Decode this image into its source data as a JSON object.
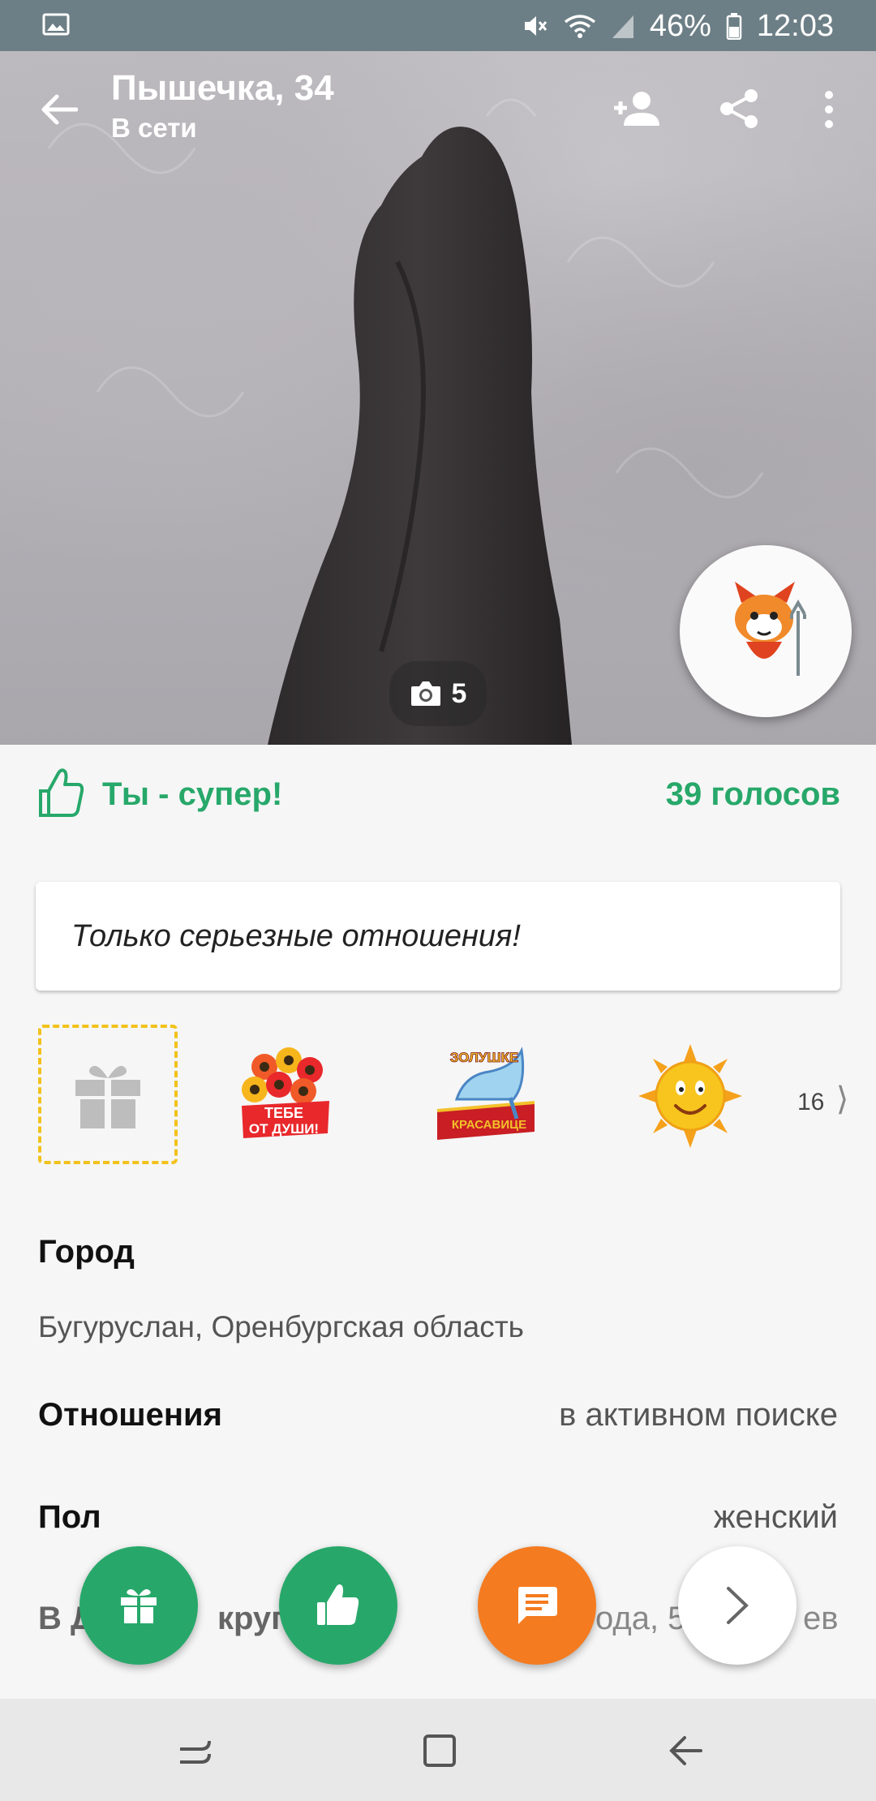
{
  "status_bar": {
    "battery": "46%",
    "time": "12:03"
  },
  "profile": {
    "name": "Пышечка, 34",
    "online": "В сети"
  },
  "photo": {
    "count": "5"
  },
  "rating": {
    "text": "Ты - супер!",
    "votes": "39 голосов"
  },
  "status_message": "Только серьезные отношения!",
  "gifts": {
    "more_count": "16",
    "items": [
      {
        "name": "flowers-sticker",
        "caption_top": "ТЕБЕ",
        "caption_bottom": "ОТ ДУШИ!"
      },
      {
        "name": "shoe-sticker",
        "caption_top": "ЗОЛУШКЕ",
        "caption_bottom": "КРАСАВИЦЕ"
      },
      {
        "name": "sun-sticker"
      }
    ]
  },
  "info": {
    "city_label": "Город",
    "city_value": "Бугуруслан, Оренбургская область",
    "relations_label": "Отношения",
    "relations_value": "в активном поиске",
    "gender_label": "Пол",
    "gender_value": "женский",
    "friends_label": "В Д",
    "friends_label_tail": "круге",
    "friends_value": "ода, 5",
    "friends_value_tail": "ев"
  },
  "colors": {
    "accent": "#27a86a",
    "orange": "#f47b20",
    "gift_border": "#f2c21b"
  },
  "icons": {
    "back": "arrow-left-icon",
    "add_friend": "person-add-icon",
    "share": "share-icon",
    "more": "more-vert-icon",
    "camera": "camera-icon",
    "like": "thumb-up-icon",
    "gift": "gift-icon",
    "message": "message-icon",
    "next": "chevron-right-icon"
  }
}
